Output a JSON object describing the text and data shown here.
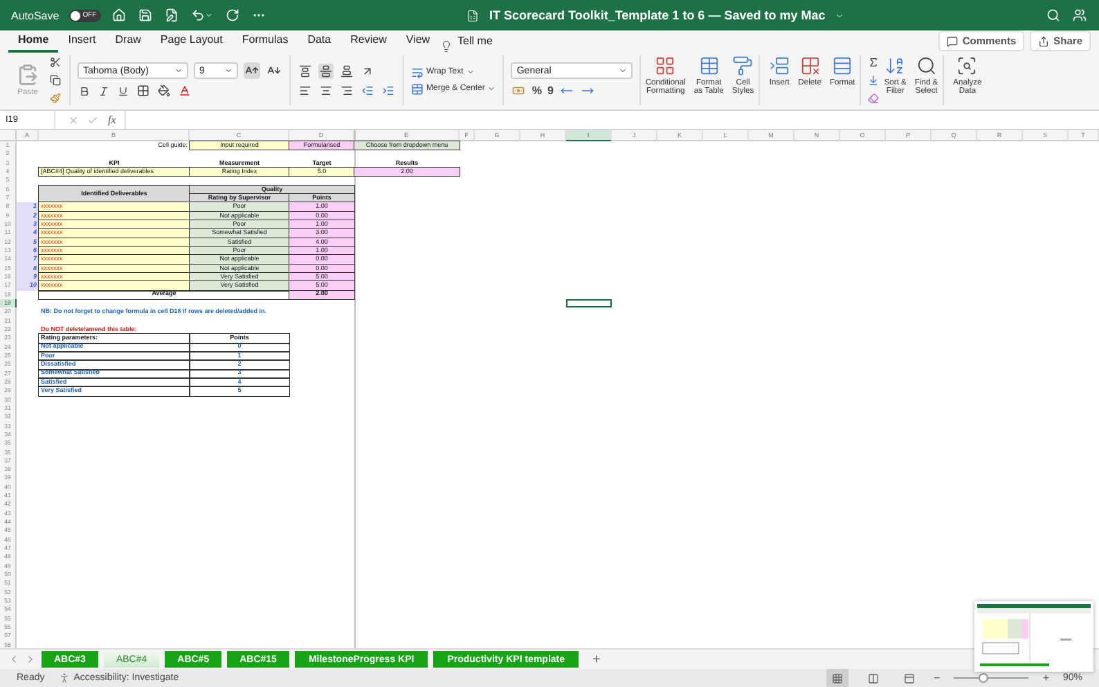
{
  "title_bar": {
    "autosave_label": "AutoSave",
    "autosave": {
      "on": false,
      "label": "OFF"
    },
    "title": "IT Scorecard Toolkit_Template 1 to 6 — Saved to my Mac"
  },
  "ribbon_tabs": [
    {
      "label": "Home",
      "selected": true
    },
    {
      "label": "Insert",
      "selected": false
    },
    {
      "label": "Draw",
      "selected": false
    },
    {
      "label": "Page Layout",
      "selected": false
    },
    {
      "label": "Formulas",
      "selected": false
    },
    {
      "label": "Data",
      "selected": false
    },
    {
      "label": "Review",
      "selected": false
    },
    {
      "label": "View",
      "selected": false
    }
  ],
  "tell_me": "Tell me",
  "ribbon_actions": [
    {
      "kind": "comments",
      "label": "Comments"
    },
    {
      "kind": "share",
      "label": "Share"
    }
  ],
  "ribbon": {
    "paste": "Paste",
    "font": "Tahoma (Body)",
    "font_size": "9",
    "wrap_text": "Wrap Text",
    "merge_center": "Merge & Center",
    "number_format": "General",
    "percent": "%",
    "comma": "9",
    "large_buttons": [
      {
        "kind": "conditional",
        "label": "Conditional\nFormatting"
      },
      {
        "kind": "table",
        "label": "Format\nas Table"
      },
      {
        "kind": "styles",
        "label": "Cell\nStyles"
      },
      {
        "kind": "insert",
        "label": "Insert"
      },
      {
        "kind": "delete",
        "label": "Delete"
      },
      {
        "kind": "format",
        "label": "Format"
      },
      {
        "kind": "sort",
        "label": "Sort &\nFilter"
      },
      {
        "kind": "find",
        "label": "Find &\nSelect"
      },
      {
        "kind": "analyze",
        "label": "Analyze\nData"
      }
    ]
  },
  "formula_bar": {
    "name_box": "I19",
    "fx": "fx"
  },
  "columns": [
    {
      "label": "A",
      "selected": false
    },
    {
      "label": "B",
      "selected": false
    },
    {
      "label": "C",
      "selected": false
    },
    {
      "label": "D",
      "selected": false
    },
    {
      "label": "E",
      "selected": false
    },
    {
      "label": "F",
      "selected": false
    },
    {
      "label": "G",
      "selected": false
    },
    {
      "label": "H",
      "selected": false
    },
    {
      "label": "I",
      "selected": true
    },
    {
      "label": "J",
      "selected": false
    },
    {
      "label": "K",
      "selected": false
    },
    {
      "label": "L",
      "selected": false
    },
    {
      "label": "M",
      "selected": false
    },
    {
      "label": "N",
      "selected": false
    },
    {
      "label": "O",
      "selected": false
    },
    {
      "label": "P",
      "selected": false
    },
    {
      "label": "Q",
      "selected": false
    },
    {
      "label": "R",
      "selected": false
    },
    {
      "label": "S",
      "selected": false
    },
    {
      "label": "T",
      "selected": false
    }
  ],
  "rows": [
    {
      "number": "1",
      "selected": false,
      "cells": [
        {
          "kind": "blank"
        },
        {
          "kind": "guide-label",
          "text": "Cell guide:"
        },
        {
          "kind": "input",
          "text": "Input required"
        },
        {
          "kind": "formula",
          "text": "Formularised"
        },
        {
          "kind": "dropdown",
          "text": "Choose from dropdown menu"
        }
      ]
    },
    {
      "number": "2",
      "selected": false
    },
    {
      "number": "3",
      "selected": false,
      "cells": [
        {
          "kind": "blank"
        },
        {
          "kind": "heading",
          "text": "KPI"
        },
        {
          "kind": "heading",
          "text": "Measurement"
        },
        {
          "kind": "heading",
          "text": "Target"
        },
        {
          "kind": "heading",
          "text": "Results"
        }
      ]
    },
    {
      "number": "4",
      "selected": false,
      "cells": [
        {
          "kind": "blank"
        },
        {
          "kind": "input-text",
          "text": "[ABC#4] Quality of identified deliverables"
        },
        {
          "kind": "input",
          "text": "Rating Index"
        },
        {
          "kind": "input",
          "text": "5.0"
        },
        {
          "kind": "formula",
          "text": "2.00"
        }
      ]
    },
    {
      "number": "5",
      "selected": false
    },
    {
      "number": "6",
      "selected": false,
      "cells": [
        {
          "kind": "blank"
        },
        {
          "kind": "header",
          "text": "Identified Deliverables",
          "merge_down": true
        },
        {
          "kind": "header",
          "text": "Quality",
          "merge_right": true
        }
      ]
    },
    {
      "number": "7",
      "selected": false,
      "cells": [
        {
          "kind": "blank"
        },
        {
          "kind": "blank"
        },
        {
          "kind": "header",
          "text": "Rating by Supervisor"
        },
        {
          "kind": "header",
          "text": "Points"
        }
      ]
    },
    {
      "number": "8",
      "selected": false,
      "cells": [
        {
          "kind": "index",
          "text": "1"
        },
        {
          "kind": "item",
          "text": "xxxxxxx"
        },
        {
          "kind": "dropdown",
          "text": "Poor"
        },
        {
          "kind": "formula",
          "text": "1.00"
        }
      ]
    },
    {
      "number": "9",
      "selected": false,
      "cells": [
        {
          "kind": "index",
          "text": "2"
        },
        {
          "kind": "item",
          "text": "xxxxxxx"
        },
        {
          "kind": "dropdown",
          "text": "Not applicable"
        },
        {
          "kind": "formula",
          "text": "0.00"
        }
      ]
    },
    {
      "number": "10",
      "selected": false,
      "cells": [
        {
          "kind": "index",
          "text": "3"
        },
        {
          "kind": "item",
          "text": "xxxxxxx"
        },
        {
          "kind": "dropdown",
          "text": "Poor"
        },
        {
          "kind": "formula",
          "text": "1.00"
        }
      ]
    },
    {
      "number": "11",
      "selected": false,
      "cells": [
        {
          "kind": "index",
          "text": "4"
        },
        {
          "kind": "item",
          "text": "xxxxxxx"
        },
        {
          "kind": "dropdown",
          "text": "Somewhat Satisfied"
        },
        {
          "kind": "formula",
          "text": "3.00"
        }
      ]
    },
    {
      "number": "12",
      "selected": false,
      "cells": [
        {
          "kind": "index",
          "text": "5"
        },
        {
          "kind": "item",
          "text": "xxxxxxx"
        },
        {
          "kind": "dropdown",
          "text": "Satisfied"
        },
        {
          "kind": "formula",
          "text": "4.00"
        }
      ]
    },
    {
      "number": "13",
      "selected": false,
      "cells": [
        {
          "kind": "index",
          "text": "6"
        },
        {
          "kind": "item",
          "text": "xxxxxxx"
        },
        {
          "kind": "dropdown",
          "text": "Poor"
        },
        {
          "kind": "formula",
          "text": "1.00"
        }
      ]
    },
    {
      "number": "14",
      "selected": false,
      "cells": [
        {
          "kind": "index",
          "text": "7"
        },
        {
          "kind": "item",
          "text": "xxxxxxx"
        },
        {
          "kind": "dropdown",
          "text": "Not applicable"
        },
        {
          "kind": "formula",
          "text": "0.00"
        }
      ]
    },
    {
      "number": "15",
      "selected": false,
      "cells": [
        {
          "kind": "index",
          "text": "8"
        },
        {
          "kind": "item",
          "text": "xxxxxxx"
        },
        {
          "kind": "dropdown",
          "text": "Not applicable"
        },
        {
          "kind": "formula",
          "text": "0.00"
        }
      ]
    },
    {
      "number": "16",
      "selected": false,
      "cells": [
        {
          "kind": "index",
          "text": "9"
        },
        {
          "kind": "item",
          "text": "xxxxxxx"
        },
        {
          "kind": "dropdown",
          "text": "Very Satisfied"
        },
        {
          "kind": "formula",
          "text": "5.00"
        }
      ]
    },
    {
      "number": "17",
      "selected": false,
      "cells": [
        {
          "kind": "index",
          "text": "10"
        },
        {
          "kind": "item",
          "text": "xxxxxxx"
        },
        {
          "kind": "dropdown",
          "text": "Very Satisfied"
        },
        {
          "kind": "formula",
          "text": "5.00"
        }
      ]
    },
    {
      "number": "18",
      "selected": false,
      "cells": [
        {
          "kind": "blank"
        },
        {
          "kind": "average",
          "text": "Average",
          "merge_right": true
        },
        {
          "kind": "blank"
        },
        {
          "kind": "total",
          "text": "2.00"
        }
      ]
    },
    {
      "number": "19",
      "selected": true
    },
    {
      "number": "20",
      "selected": false,
      "cells": [
        {
          "kind": "blank"
        },
        {
          "kind": "note",
          "text": "NB: Do not forget to change formula in cell D18 if rows are deleted/added in."
        }
      ]
    },
    {
      "number": "21",
      "selected": false
    },
    {
      "number": "22",
      "selected": false,
      "cells": [
        {
          "kind": "blank"
        },
        {
          "kind": "warning",
          "text": "Do NOT delete/amend this table:"
        }
      ]
    },
    {
      "number": "23",
      "selected": false,
      "cells": [
        {
          "kind": "blank"
        },
        {
          "kind": "param-head",
          "text": "Rating parameters:"
        },
        {
          "kind": "points-head",
          "text": "Points"
        }
      ]
    },
    {
      "number": "24",
      "selected": false,
      "cells": [
        {
          "kind": "blank"
        },
        {
          "kind": "param",
          "text": "Not applicable"
        },
        {
          "kind": "param-points",
          "text": "0"
        }
      ]
    },
    {
      "number": "25",
      "selected": false,
      "cells": [
        {
          "kind": "blank"
        },
        {
          "kind": "param",
          "text": "Poor"
        },
        {
          "kind": "param-points",
          "text": "1"
        }
      ]
    },
    {
      "number": "26",
      "selected": false,
      "cells": [
        {
          "kind": "blank"
        },
        {
          "kind": "param",
          "text": "Dissatisfied"
        },
        {
          "kind": "param-points",
          "text": "2"
        }
      ]
    },
    {
      "number": "27",
      "selected": false,
      "cells": [
        {
          "kind": "blank"
        },
        {
          "kind": "param",
          "text": "Somewhat Satisfied"
        },
        {
          "kind": "param-points",
          "text": "3"
        }
      ]
    },
    {
      "number": "28",
      "selected": false,
      "cells": [
        {
          "kind": "blank"
        },
        {
          "kind": "param",
          "text": "Satisfied"
        },
        {
          "kind": "param-points",
          "text": "4"
        }
      ]
    },
    {
      "number": "29",
      "selected": false,
      "cells": [
        {
          "kind": "blank"
        },
        {
          "kind": "param",
          "text": "Very Satisfied"
        },
        {
          "kind": "param-points",
          "text": "5"
        }
      ]
    },
    {
      "number": "30",
      "selected": false
    },
    {
      "number": "31",
      "selected": false
    },
    {
      "number": "32",
      "selected": false
    },
    {
      "number": "33",
      "selected": false
    },
    {
      "number": "34",
      "selected": false
    },
    {
      "number": "35",
      "selected": false
    },
    {
      "number": "36",
      "selected": false
    },
    {
      "number": "37",
      "selected": false
    },
    {
      "number": "38",
      "selected": false
    },
    {
      "number": "39",
      "selected": false
    },
    {
      "number": "40",
      "selected": false
    },
    {
      "number": "41",
      "selected": false
    },
    {
      "number": "42",
      "selected": false
    },
    {
      "number": "43",
      "selected": false
    },
    {
      "number": "44",
      "selected": false
    },
    {
      "number": "45",
      "selected": false
    },
    {
      "number": "46",
      "selected": false
    },
    {
      "number": "47",
      "selected": false
    },
    {
      "number": "48",
      "selected": false
    },
    {
      "number": "49",
      "selected": false
    },
    {
      "number": "50",
      "selected": false
    },
    {
      "number": "51",
      "selected": false
    },
    {
      "number": "52",
      "selected": false
    },
    {
      "number": "53",
      "selected": false
    },
    {
      "number": "54",
      "selected": false
    },
    {
      "number": "55",
      "selected": false
    },
    {
      "number": "56",
      "selected": false
    },
    {
      "number": "57",
      "selected": false
    },
    {
      "number": "58",
      "selected": false
    }
  ],
  "sheet_tabs": [
    {
      "label": "ABC#3",
      "selected": false
    },
    {
      "label": "ABC#4",
      "selected": true
    },
    {
      "label": "ABC#5",
      "selected": false
    },
    {
      "label": "ABC#15",
      "selected": false
    },
    {
      "label": "MilestoneProgress KPI",
      "selected": false
    },
    {
      "label": "Productivity KPI template",
      "selected": false
    }
  ],
  "add_sheet": "+",
  "status_bar": {
    "ready": "Ready",
    "accessibility": "Accessibility: Investigate",
    "views": [
      {
        "kind": "normal",
        "selected": true
      },
      {
        "kind": "page-break",
        "selected": false
      },
      {
        "kind": "page-layout",
        "selected": false
      }
    ],
    "zoom": {
      "minus": "−",
      "plus": "+",
      "level": 0.4,
      "reading": "90%"
    }
  }
}
